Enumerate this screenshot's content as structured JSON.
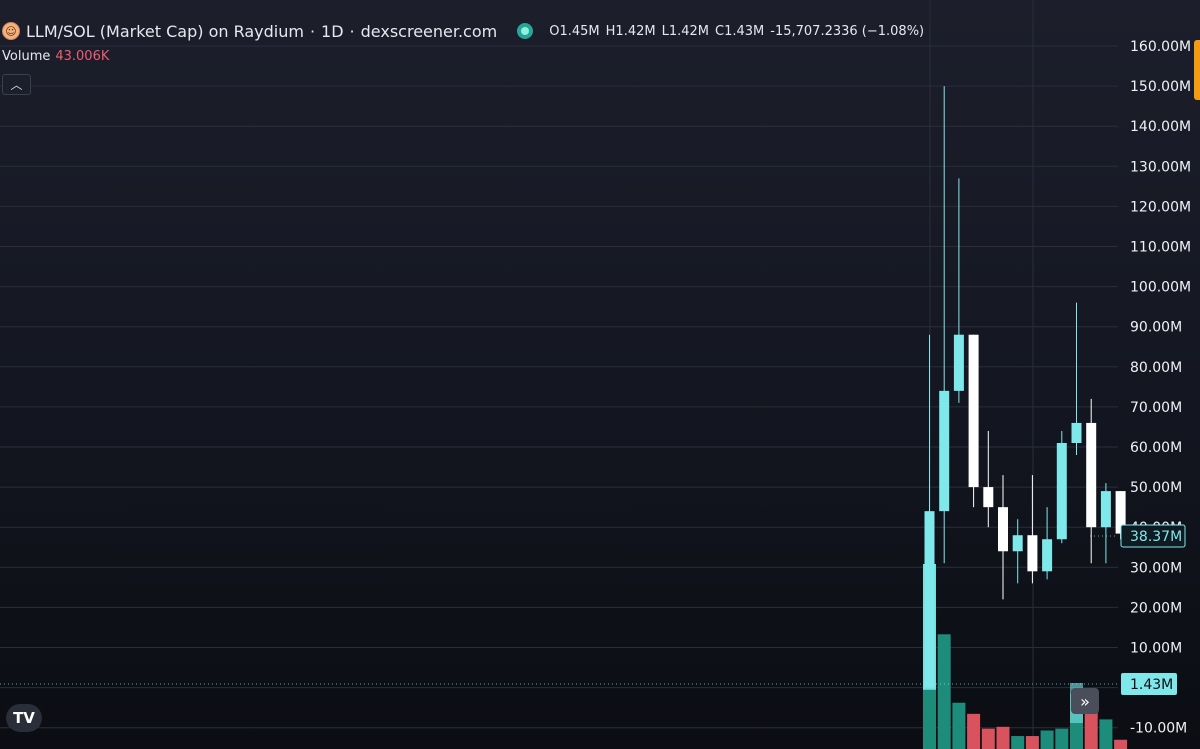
{
  "legend": {
    "pair": "LLM/SOL (Market Cap) on Raydium",
    "sep1": "·",
    "interval": "1D",
    "sep2": "·",
    "source": "dexscreener.com",
    "ohlc": {
      "o_label": "O",
      "o": "1.45M",
      "h_label": "H",
      "h": "1.42M",
      "l_label": "L",
      "l": "1.42M",
      "c_label": "C",
      "c": "1.43M",
      "change": "-15,707.2336 (−1.08%)"
    }
  },
  "volume_legend": {
    "label": "Volume",
    "value": "43.006K"
  },
  "controls": {
    "collapse_icon": "chevron-up-icon",
    "scroll_icon": "double-chevron-right-icon",
    "logo": "tradingview-logo"
  },
  "colors": {
    "up": "#7fe8ea",
    "down": "#ffffff",
    "vol_up": "#1e8c7a",
    "vol_down": "#d9535f",
    "last_volume_up": "#7fe8ea",
    "badge_price_bg": "#0f1a22",
    "badge_price_border": "#7fe8ea"
  },
  "chart_data": {
    "type": "candlestick",
    "y_axis_ticks": [
      "160.00M",
      "150.00M",
      "140.00M",
      "130.00M",
      "120.00M",
      "110.00M",
      "100.00M",
      "90.00M",
      "80.00M",
      "70.00M",
      "60.00M",
      "50.00M",
      "40.00M",
      "30.00M",
      "20.00M",
      "10.00M",
      "0.00",
      "-10.00M"
    ],
    "ylim": [
      -13,
      162
    ],
    "price_label": "38.37M",
    "volume_label": "1.43M",
    "candles": [
      {
        "open": 0,
        "high": 88,
        "low": 0,
        "close": 44
      },
      {
        "open": 44,
        "high": 150,
        "low": 31,
        "close": 74
      },
      {
        "open": 74,
        "high": 127,
        "low": 71,
        "close": 88
      },
      {
        "open": 88,
        "high": 88,
        "low": 45,
        "close": 50
      },
      {
        "open": 50,
        "high": 64,
        "low": 40,
        "close": 45
      },
      {
        "open": 45,
        "high": 53,
        "low": 22,
        "close": 34
      },
      {
        "open": 34,
        "high": 42,
        "low": 26,
        "close": 38
      },
      {
        "open": 38,
        "high": 53,
        "low": 26,
        "close": 29
      },
      {
        "open": 29,
        "high": 45,
        "low": 27,
        "close": 37
      },
      {
        "open": 37,
        "high": 64,
        "low": 36,
        "close": 61
      },
      {
        "open": 61,
        "high": 96,
        "low": 58,
        "close": 66
      },
      {
        "open": 66,
        "high": 72,
        "low": 31,
        "close": 40
      },
      {
        "open": 40,
        "high": 51,
        "low": 31,
        "close": 49
      },
      {
        "open": 49,
        "high": 49,
        "low": 37,
        "close": 38.4
      }
    ],
    "volume_bars": [
      {
        "value": 100,
        "dir": "up"
      },
      {
        "value": 62,
        "dir": "up"
      },
      {
        "value": 25,
        "dir": "up"
      },
      {
        "value": 19,
        "dir": "down"
      },
      {
        "value": 11,
        "dir": "down"
      },
      {
        "value": 12,
        "dir": "down"
      },
      {
        "value": 7,
        "dir": "up"
      },
      {
        "value": 7,
        "dir": "down"
      },
      {
        "value": 10,
        "dir": "up"
      },
      {
        "value": 11,
        "dir": "up"
      },
      {
        "value": 30,
        "dir": "up"
      },
      {
        "value": 28,
        "dir": "down"
      },
      {
        "value": 16,
        "dir": "up"
      },
      {
        "value": 5,
        "dir": "down"
      }
    ]
  }
}
